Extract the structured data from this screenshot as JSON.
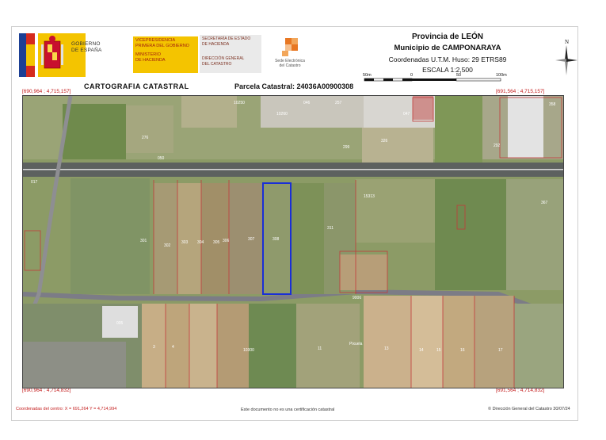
{
  "header": {
    "gobierno_lines": [
      "GOBIERNO",
      "DE ESPAÑA"
    ],
    "vice_lines": [
      "VICEPRESIDENCIA",
      "PRIMERA DEL GOBIERNO",
      "MINISTERIO",
      "DE HACIENDA"
    ],
    "state_lines": [
      "SECRETARÍA DE ESTADO",
      "DE HACIENDA",
      "DIRECCIÓN GENERAL",
      "DEL CATASTRO"
    ],
    "sede_lines": [
      "Sede Electrónica",
      "del Catastro"
    ],
    "provincia": "Provincia de LEÓN",
    "municipio": "Municipio de CAMPONARAYA",
    "coordenadas": "Coordenadas U.T.M. Huso: 29 ETRS89",
    "escala": "ESCALA 1:2,500",
    "north_label": "N"
  },
  "scale_bar": {
    "labels": [
      "50m",
      "0",
      "50",
      "100m"
    ]
  },
  "titles": {
    "cartografia": "CARTOGRAFIA CATASTRAL",
    "parcela": "Parcela Catastral: 24036A00900308"
  },
  "corners": {
    "top_left": "[690,964 ; 4,715,157]",
    "top_right": "[691,564 ; 4,715,157]",
    "bottom_left": "[690,964 ; 4,714,832]",
    "bottom_right": "[691,564 ; 4,714,832]"
  },
  "map": {
    "parcel_labels": [
      "10250",
      "046",
      "10260",
      "047",
      "257",
      "326",
      "276",
      "292",
      "299",
      "358",
      "301",
      "302",
      "303",
      "304",
      "305",
      "306",
      "307",
      "308",
      "311",
      "15313",
      "367",
      "9006",
      "11",
      "13",
      "14",
      "15",
      "16",
      "17",
      "3",
      "4",
      "10300",
      "Pixuela",
      "005",
      "017",
      "050"
    ],
    "colors": {
      "parcel_boundary": "#c23a3a",
      "selected_parcel": "#1a2fd6",
      "road": "#7c7c86"
    }
  },
  "footer": {
    "centro": "Coordenadas del centro: X = 691,264 Y = 4,714,994",
    "no_cert": "Este documento no es una certificación catastral",
    "copyright": "© Dirección General del Catastro 30/07/24"
  }
}
